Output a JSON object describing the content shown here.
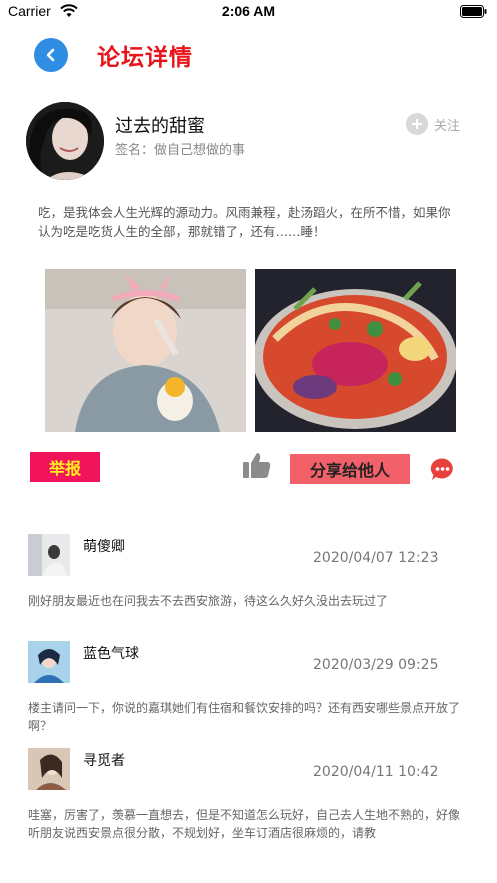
{
  "status_bar": {
    "carrier": "Carrier",
    "time": "2:06 AM"
  },
  "nav": {
    "title": "论坛详情",
    "back_icon": "chevron-left-icon"
  },
  "author": {
    "name": "过去的甜蜜",
    "signature": "签名：做自己想做的事",
    "follow_label": "关注"
  },
  "post": {
    "text": "吃，是我体会人生光辉的源动力。风雨兼程，赴汤蹈火，在所不惜，如果你认为吃是吃货人生的全部，那就错了，还有……睡！"
  },
  "actions": {
    "report_label": "举报",
    "share_label": "分享给他人"
  },
  "comments": [
    {
      "name": "萌傻卿",
      "time": "2020/04/07 12:23",
      "text": "刚好朋友最近也在问我去不去西安旅游，待这么久好久没出去玩过了"
    },
    {
      "name": "蓝色气球",
      "time": "2020/03/29 09:25",
      "text": "楼主请问一下，你说的嘉琪她们有住宿和餐饮安排的吗？还有西安哪些景点开放了啊？"
    },
    {
      "name": "寻觅者",
      "time": "2020/04/11 10:42",
      "text": "哇塞，厉害了，羡慕一直想去，但是不知道怎么玩好，自己去人生地不熟的，好像听朋友说西安景点很分散，不规划好，坐车订酒店很麻烦的，请教"
    }
  ],
  "colors": {
    "title_red": "#e8141b",
    "back_blue": "#2f8de4",
    "report_bg": "#f2145b",
    "report_text": "#ffef1a",
    "share_bg": "#f2616a",
    "comment_icon_red": "#e8413c"
  }
}
